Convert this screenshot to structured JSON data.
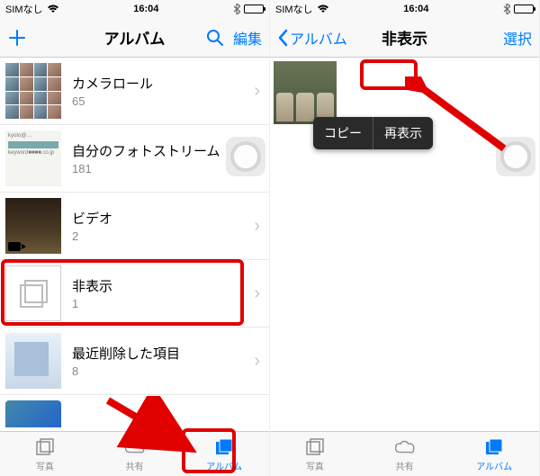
{
  "accent": "#007aff",
  "highlight": "#e00000",
  "statusbar": {
    "carrier": "SIMなし",
    "time": "16:04"
  },
  "left": {
    "nav": {
      "title": "アルバム",
      "edit": "編集"
    },
    "albums": [
      {
        "title": "カメラロール",
        "count": "65"
      },
      {
        "title": "自分のフォトストリーム",
        "count": "181"
      },
      {
        "title": "ビデオ",
        "count": "2"
      },
      {
        "title": "非表示",
        "count": "1"
      },
      {
        "title": "最近削除した項目",
        "count": "8"
      }
    ],
    "tabs": {
      "photos": "写真",
      "shared": "共有",
      "albums": "アルバム"
    }
  },
  "right": {
    "nav": {
      "back": "アルバム",
      "title": "非表示",
      "select": "選択"
    },
    "popup": {
      "copy": "コピー",
      "unhide": "再表示"
    },
    "tabs": {
      "photos": "写真",
      "shared": "共有",
      "albums": "アルバム"
    }
  }
}
